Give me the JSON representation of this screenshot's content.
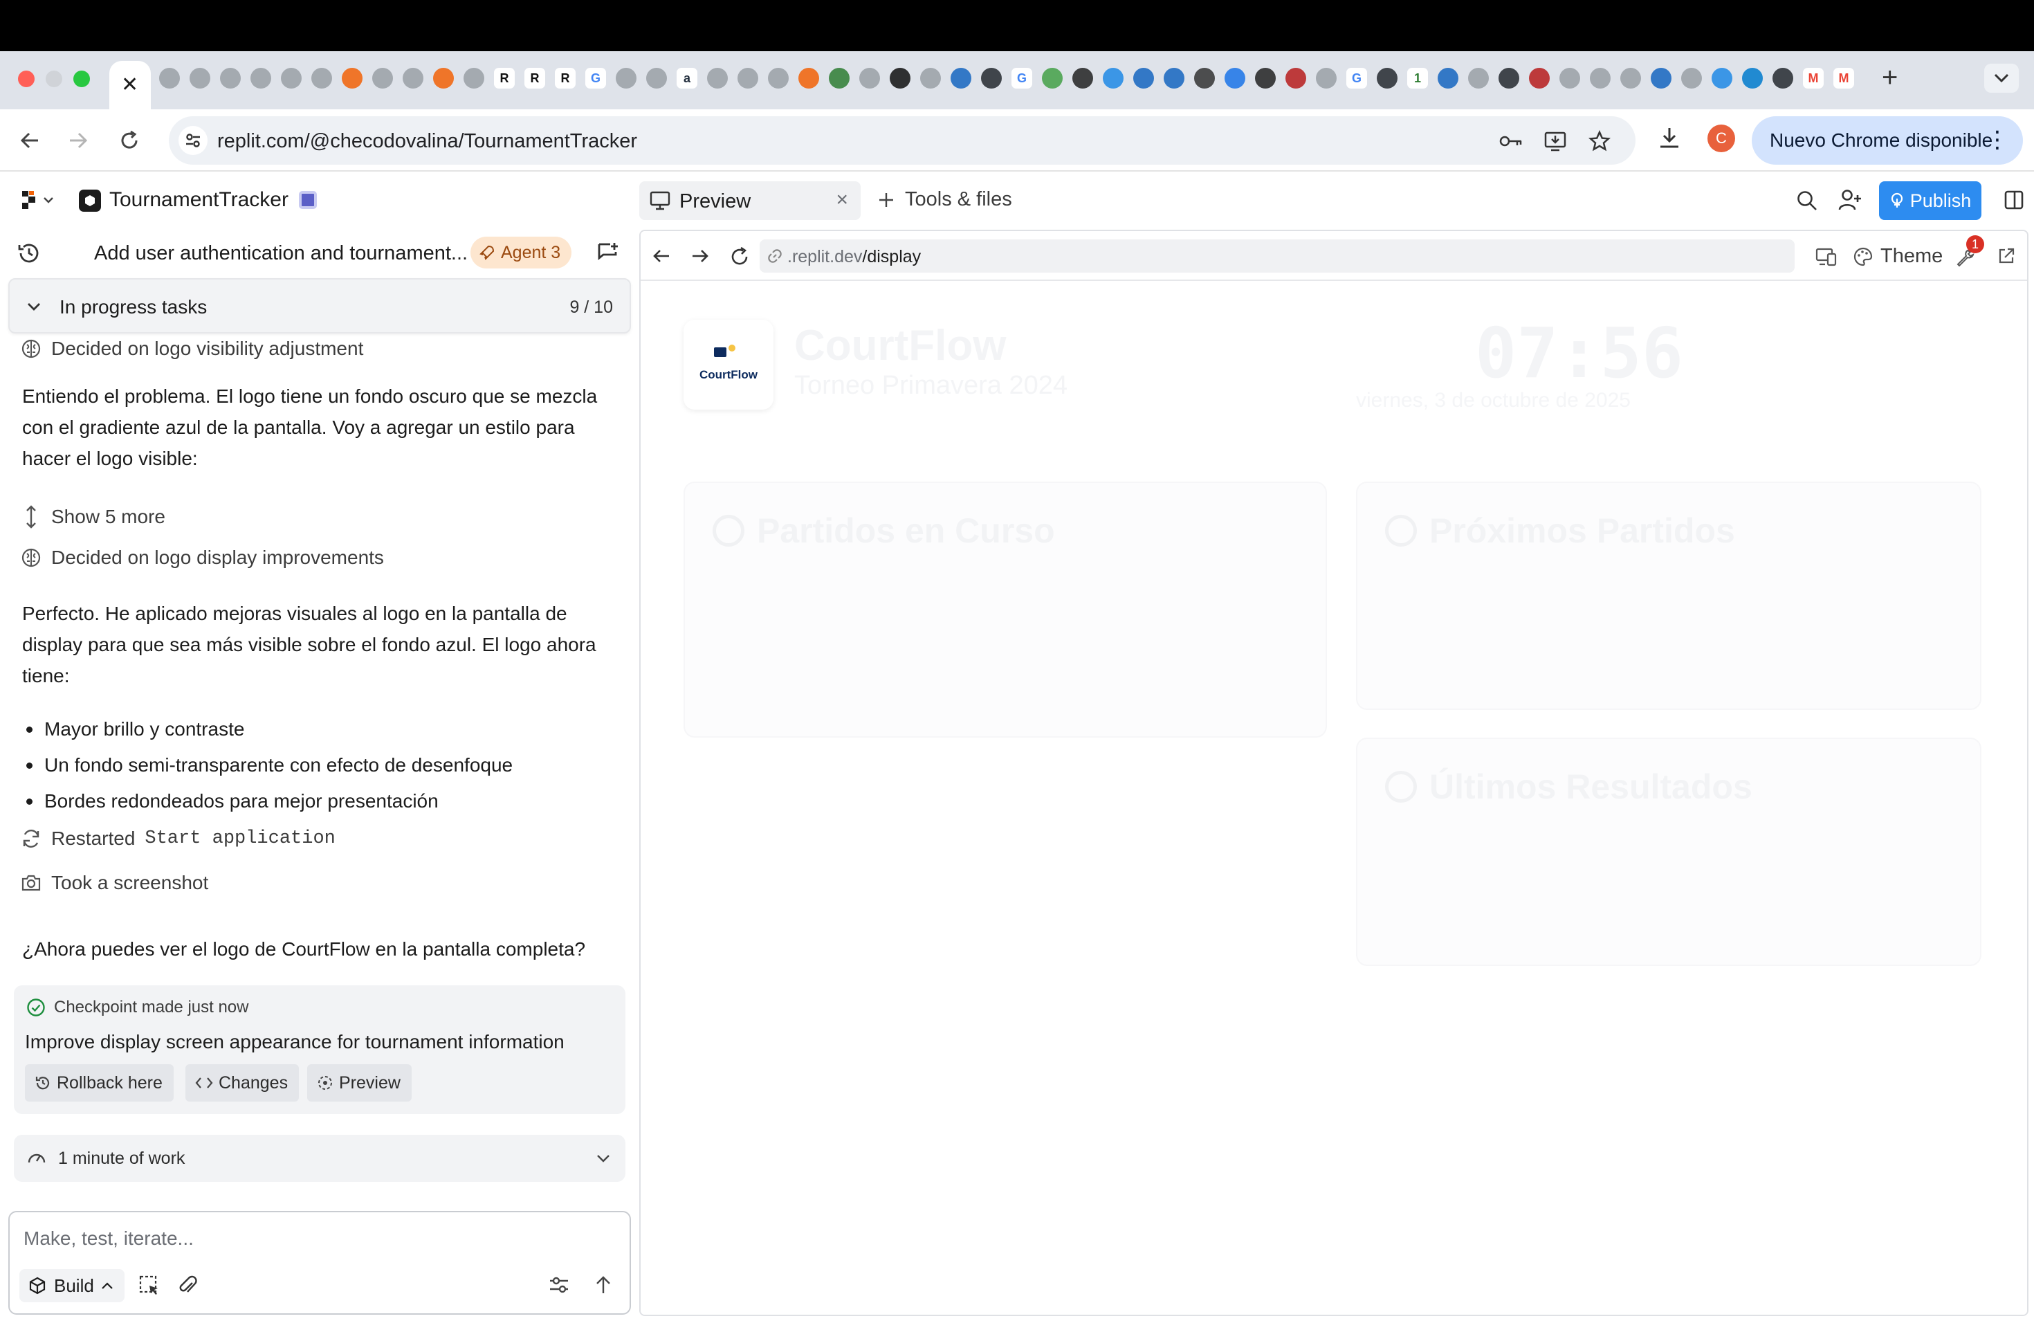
{
  "browser": {
    "url": "replit.com/@checodovalina/TournamentTracker",
    "profile_initial": "C",
    "update_label": "Nuevo Chrome disponible",
    "tab_favicons": [
      {
        "glyph": "",
        "color": "#9aa0a6"
      },
      {
        "glyph": "",
        "color": "#9aa0a6"
      },
      {
        "glyph": "",
        "color": "#9aa0a6"
      },
      {
        "glyph": "",
        "color": "#9aa0a6"
      },
      {
        "glyph": "",
        "color": "#9aa0a6"
      },
      {
        "glyph": "",
        "color": "#9aa0a6"
      },
      {
        "glyph": "",
        "color": "#f26207"
      },
      {
        "glyph": "",
        "color": "#9aa0a6"
      },
      {
        "glyph": "",
        "color": "#9aa0a6"
      },
      {
        "glyph": "",
        "color": "#f26207"
      },
      {
        "glyph": "",
        "color": "#9aa0a6"
      },
      {
        "glyph": "R",
        "color": "#111111"
      },
      {
        "glyph": "R",
        "color": "#111111"
      },
      {
        "glyph": "R",
        "color": "#111111"
      },
      {
        "glyph": "G",
        "color": "#4285f4"
      },
      {
        "glyph": "",
        "color": "#9aa0a6"
      },
      {
        "glyph": "",
        "color": "#9aa0a6"
      },
      {
        "glyph": "a",
        "color": "#232f3e"
      },
      {
        "glyph": "",
        "color": "#9aa0a6"
      },
      {
        "glyph": "",
        "color": "#9aa0a6"
      },
      {
        "glyph": "",
        "color": "#9aa0a6"
      },
      {
        "glyph": "",
        "color": "#f26207"
      },
      {
        "glyph": "",
        "color": "#2e7d32"
      },
      {
        "glyph": "",
        "color": "#9aa0a6"
      },
      {
        "glyph": "",
        "color": "#111111"
      },
      {
        "glyph": "",
        "color": "#9aa0a6"
      },
      {
        "glyph": "",
        "color": "#1565c0"
      },
      {
        "glyph": "",
        "color": "#24292f"
      },
      {
        "glyph": "G",
        "color": "#4285f4"
      },
      {
        "glyph": "",
        "color": "#43a047"
      },
      {
        "glyph": "",
        "color": "#222222"
      },
      {
        "glyph": "",
        "color": "#1e88e5"
      },
      {
        "glyph": "",
        "color": "#1565c0"
      },
      {
        "glyph": "",
        "color": "#1565c0"
      },
      {
        "glyph": "",
        "color": "#333333"
      },
      {
        "glyph": "",
        "color": "#1a73e8"
      },
      {
        "glyph": "",
        "color": "#222222"
      },
      {
        "glyph": "",
        "color": "#b71c1c"
      },
      {
        "glyph": "",
        "color": "#9aa0a6"
      },
      {
        "glyph": "G",
        "color": "#4285f4"
      },
      {
        "glyph": "",
        "color": "#24292f"
      },
      {
        "glyph": "1",
        "color": "#2e7d32"
      },
      {
        "glyph": "",
        "color": "#1565c0"
      },
      {
        "glyph": "",
        "color": "#9aa0a6"
      },
      {
        "glyph": "",
        "color": "#24292f"
      },
      {
        "glyph": "",
        "color": "#b71c1c"
      },
      {
        "glyph": "",
        "color": "#9aa0a6"
      },
      {
        "glyph": "",
        "color": "#9aa0a6"
      },
      {
        "glyph": "",
        "color": "#9aa0a6"
      },
      {
        "glyph": "",
        "color": "#1565c0"
      },
      {
        "glyph": "",
        "color": "#9aa0a6"
      },
      {
        "glyph": "",
        "color": "#1e88e5"
      },
      {
        "glyph": "",
        "color": "#007acc"
      },
      {
        "glyph": "",
        "color": "#24292f"
      },
      {
        "glyph": "M",
        "color": "#ea4335"
      },
      {
        "glyph": "M",
        "color": "#ea4335"
      }
    ]
  },
  "workspace": {
    "project_name": "TournamentTracker",
    "chat_title": "Add user authentication and tournament...",
    "agent_badge": "Agent 3",
    "tasks_label": "In progress tasks",
    "tasks_count": "9 / 10"
  },
  "chat": {
    "step_1": "Decided on logo visibility adjustment",
    "message_1": "Entiendo el problema. El logo tiene un fondo oscuro que se mezcla con el gradiente azul de la pantalla. Voy a agregar un estilo para hacer el logo visible:",
    "show_more": "Show 5 more",
    "step_2": "Decided on logo display improvements",
    "message_2": "Perfecto. He aplicado mejoras visuales al logo en la pantalla de display para que sea más visible sobre el fondo azul. El logo ahora tiene:",
    "bullets": [
      "Mayor brillo y contraste",
      "Un fondo semi-transparente con efecto de desenfoque",
      "Bordes redondeados para mejor presentación"
    ],
    "restarted_prefix": "Restarted",
    "restarted_target": "Start application",
    "screenshot_step": "Took a screenshot",
    "question": "¿Ahora puedes ver el logo de CourtFlow en la pantalla completa?",
    "checkpoint": {
      "status": "Checkpoint made just now",
      "description": "Improve display screen appearance for tournament information",
      "rollback": "Rollback here",
      "changes": "Changes",
      "preview": "Preview"
    },
    "work_time": "1 minute of work"
  },
  "composer": {
    "placeholder": "Make, test, iterate...",
    "mode": "Build"
  },
  "panel": {
    "preview_tab": "Preview",
    "tools_tab": "Tools & files",
    "publish": "Publish",
    "preview_url_prefix": ".replit.dev",
    "preview_url_path": "/display",
    "theme": "Theme",
    "notification_count": "1"
  },
  "app": {
    "logo_text": "CourtFlow",
    "title": "CourtFlow",
    "subtitle": "Torneo Primavera 2024",
    "clock": "07:56",
    "date": "viernes, 3 de octubre de 2025",
    "section_live": "Partidos en Curso",
    "section_next": "Próximos Partidos",
    "section_results": "Últimos Resultados"
  },
  "colors": {
    "publish": "#2d8cf0",
    "agent_badge_bg": "#fde6cf",
    "profile": "#e8613c",
    "update_chip": "#d3e3fd"
  }
}
